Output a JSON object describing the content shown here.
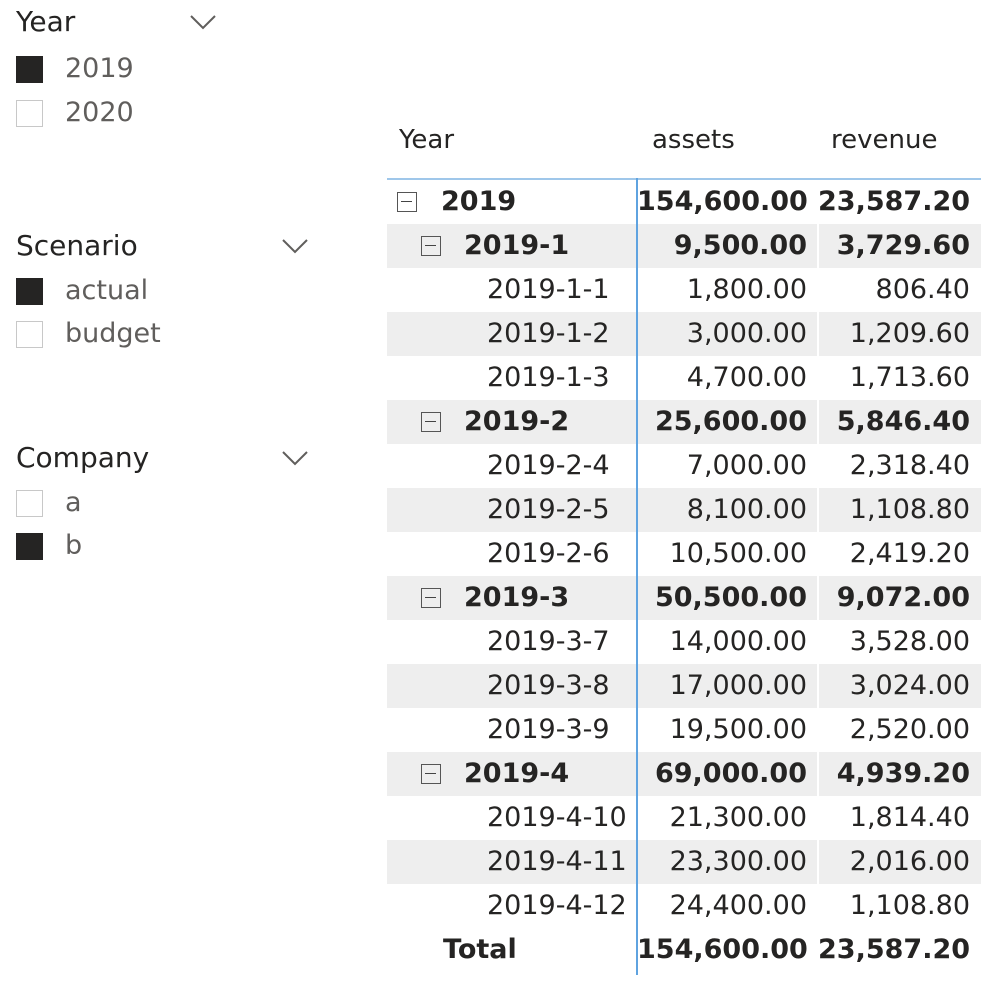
{
  "slicers": {
    "year": {
      "title": "Year",
      "items": [
        {
          "label": "2019",
          "checked": true
        },
        {
          "label": "2020",
          "checked": false
        }
      ]
    },
    "scenario": {
      "title": "Scenario",
      "items": [
        {
          "label": "actual",
          "checked": true
        },
        {
          "label": "budget",
          "checked": false
        }
      ]
    },
    "company": {
      "title": "Company",
      "items": [
        {
          "label": "a",
          "checked": false
        },
        {
          "label": "b",
          "checked": true
        }
      ]
    }
  },
  "matrix": {
    "headers": {
      "row": "Year",
      "assets": "assets",
      "revenue": "revenue"
    },
    "rows": [
      {
        "label": "2019",
        "assets": "154,600.00",
        "revenue": "23,587.20",
        "level": 0,
        "expandable": true,
        "shaded": false,
        "bold": true
      },
      {
        "label": "2019-1",
        "assets": "9,500.00",
        "revenue": "3,729.60",
        "level": 1,
        "expandable": true,
        "shaded": true,
        "bold": true
      },
      {
        "label": "2019-1-1",
        "assets": "1,800.00",
        "revenue": "806.40",
        "level": 2,
        "expandable": false,
        "shaded": false,
        "bold": false
      },
      {
        "label": "2019-1-2",
        "assets": "3,000.00",
        "revenue": "1,209.60",
        "level": 2,
        "expandable": false,
        "shaded": true,
        "bold": false
      },
      {
        "label": "2019-1-3",
        "assets": "4,700.00",
        "revenue": "1,713.60",
        "level": 2,
        "expandable": false,
        "shaded": false,
        "bold": false
      },
      {
        "label": "2019-2",
        "assets": "25,600.00",
        "revenue": "5,846.40",
        "level": 1,
        "expandable": true,
        "shaded": true,
        "bold": true
      },
      {
        "label": "2019-2-4",
        "assets": "7,000.00",
        "revenue": "2,318.40",
        "level": 2,
        "expandable": false,
        "shaded": false,
        "bold": false
      },
      {
        "label": "2019-2-5",
        "assets": "8,100.00",
        "revenue": "1,108.80",
        "level": 2,
        "expandable": false,
        "shaded": true,
        "bold": false
      },
      {
        "label": "2019-2-6",
        "assets": "10,500.00",
        "revenue": "2,419.20",
        "level": 2,
        "expandable": false,
        "shaded": false,
        "bold": false
      },
      {
        "label": "2019-3",
        "assets": "50,500.00",
        "revenue": "9,072.00",
        "level": 1,
        "expandable": true,
        "shaded": true,
        "bold": true
      },
      {
        "label": "2019-3-7",
        "assets": "14,000.00",
        "revenue": "3,528.00",
        "level": 2,
        "expandable": false,
        "shaded": false,
        "bold": false
      },
      {
        "label": "2019-3-8",
        "assets": "17,000.00",
        "revenue": "3,024.00",
        "level": 2,
        "expandable": false,
        "shaded": true,
        "bold": false
      },
      {
        "label": "2019-3-9",
        "assets": "19,500.00",
        "revenue": "2,520.00",
        "level": 2,
        "expandable": false,
        "shaded": false,
        "bold": false
      },
      {
        "label": "2019-4",
        "assets": "69,000.00",
        "revenue": "4,939.20",
        "level": 1,
        "expandable": true,
        "shaded": true,
        "bold": true
      },
      {
        "label": "2019-4-10",
        "assets": "21,300.00",
        "revenue": "1,814.40",
        "level": 2,
        "expandable": false,
        "shaded": false,
        "bold": false
      },
      {
        "label": "2019-4-11",
        "assets": "23,300.00",
        "revenue": "2,016.00",
        "level": 2,
        "expandable": false,
        "shaded": true,
        "bold": false
      },
      {
        "label": "2019-4-12",
        "assets": "24,400.00",
        "revenue": "1,108.80",
        "level": 2,
        "expandable": false,
        "shaded": false,
        "bold": false
      }
    ],
    "total": {
      "label": "Total",
      "assets": "154,600.00",
      "revenue": "23,587.20"
    }
  }
}
